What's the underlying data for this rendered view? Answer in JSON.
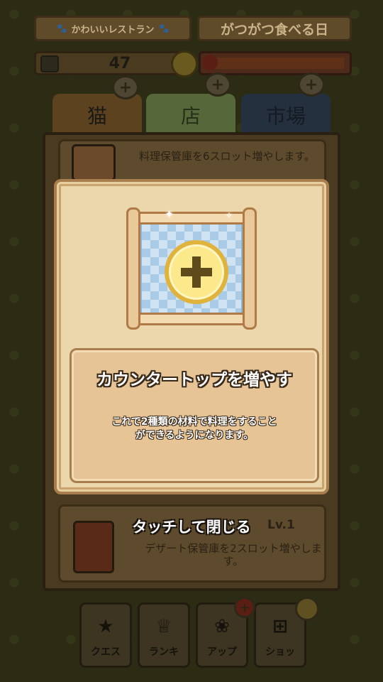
{
  "header": {
    "shop_name": "かわいいレストラン",
    "day_name": "がつがつ食べる日",
    "coins": "47"
  },
  "tabs": [
    {
      "label": "猫"
    },
    {
      "label": "店"
    },
    {
      "label": "市場"
    }
  ],
  "background_cards": {
    "card1_text": "料理保管庫を6スロット増やします。",
    "card2_title_suffix": "Lv.1",
    "card2_text": "デザート保管庫を2スロット増やします。"
  },
  "modal": {
    "title": "カウンタートップを増やす",
    "body_line1": "これで2種類の材料で料理をすること",
    "body_line2": "ができるようになります。",
    "close_hint": "タッチして閉じる"
  },
  "nav": [
    {
      "label": "クエス",
      "icon": "star-icon"
    },
    {
      "label": "ランキ",
      "icon": "trophy-icon"
    },
    {
      "label": "アップ",
      "icon": "paw-icon"
    },
    {
      "label": "ショッ",
      "icon": "basket-icon"
    }
  ],
  "colors": {
    "modal_bg": "#ecd6ac",
    "modal_border": "#a87e4e",
    "coin_yellow": "#fbe98c",
    "scroll_blue": "#a9cbe6"
  }
}
